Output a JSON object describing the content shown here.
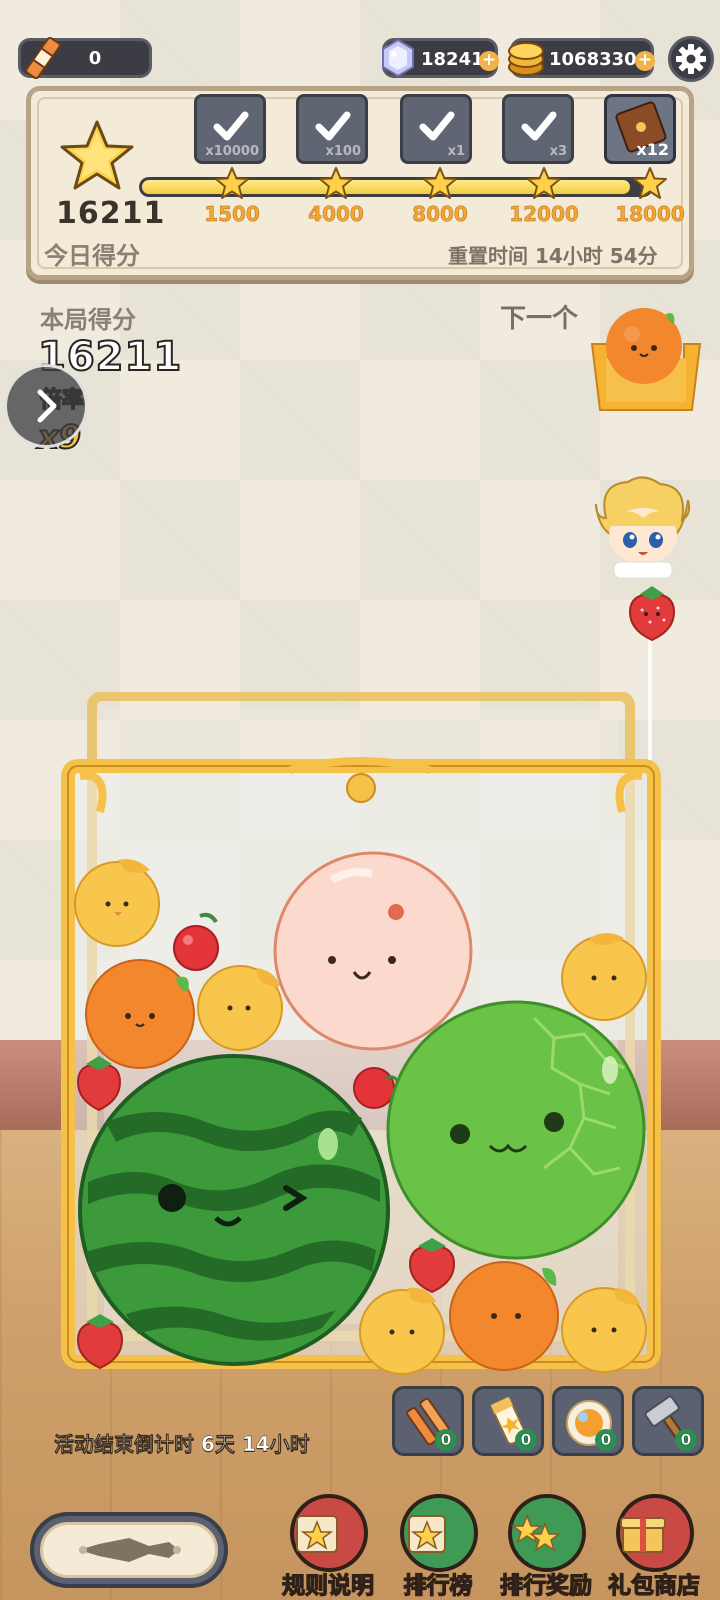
{
  "top_bar": {
    "energy_value": "0",
    "gems": "18241",
    "gold": "1068330"
  },
  "daily": {
    "score": "16211",
    "label": "今日得分",
    "reset_text": "重置时间 14小时 54分",
    "progress_fraction": 0.96,
    "rewards": [
      {
        "name": "gold-coins-reward",
        "mult": "x10000"
      },
      {
        "name": "gems-reward",
        "mult": "x100"
      },
      {
        "name": "stone-reward",
        "mult": "x1"
      },
      {
        "name": "ticket-reward",
        "mult": "x3"
      },
      {
        "name": "treasure-chest-reward",
        "mult": "x12"
      }
    ],
    "milestones": [
      "1500",
      "4000",
      "8000",
      "12000",
      "18000"
    ]
  },
  "round": {
    "score_label": "本局得分",
    "score": "16211",
    "multiplier_label": "倍率",
    "multiplier": "x9",
    "next_label": "下一个"
  },
  "countdown": "活动结束倒计时 6天 14小时",
  "tools": [
    {
      "name": "tool-candy-item",
      "count": "0"
    },
    {
      "name": "tool-bottle-item",
      "count": "0"
    },
    {
      "name": "tool-orb-item",
      "count": "0"
    },
    {
      "name": "tool-hammer-item",
      "count": "0"
    }
  ],
  "nav": [
    {
      "name": "rules-button",
      "label": "规则说明",
      "color": "#c94a45"
    },
    {
      "name": "leaderboard-button",
      "label": "排行榜",
      "color": "#3f9a55"
    },
    {
      "name": "rank-rewards-button",
      "label": "排行奖励",
      "color": "#3f9a55"
    },
    {
      "name": "gift-shop-button",
      "label": "礼包商店",
      "color": "#c94a45"
    }
  ],
  "colors": {
    "accent_gold": "#f2a634",
    "panel_bg": "#f3ead7",
    "dark_pill": "#3c3d44"
  }
}
